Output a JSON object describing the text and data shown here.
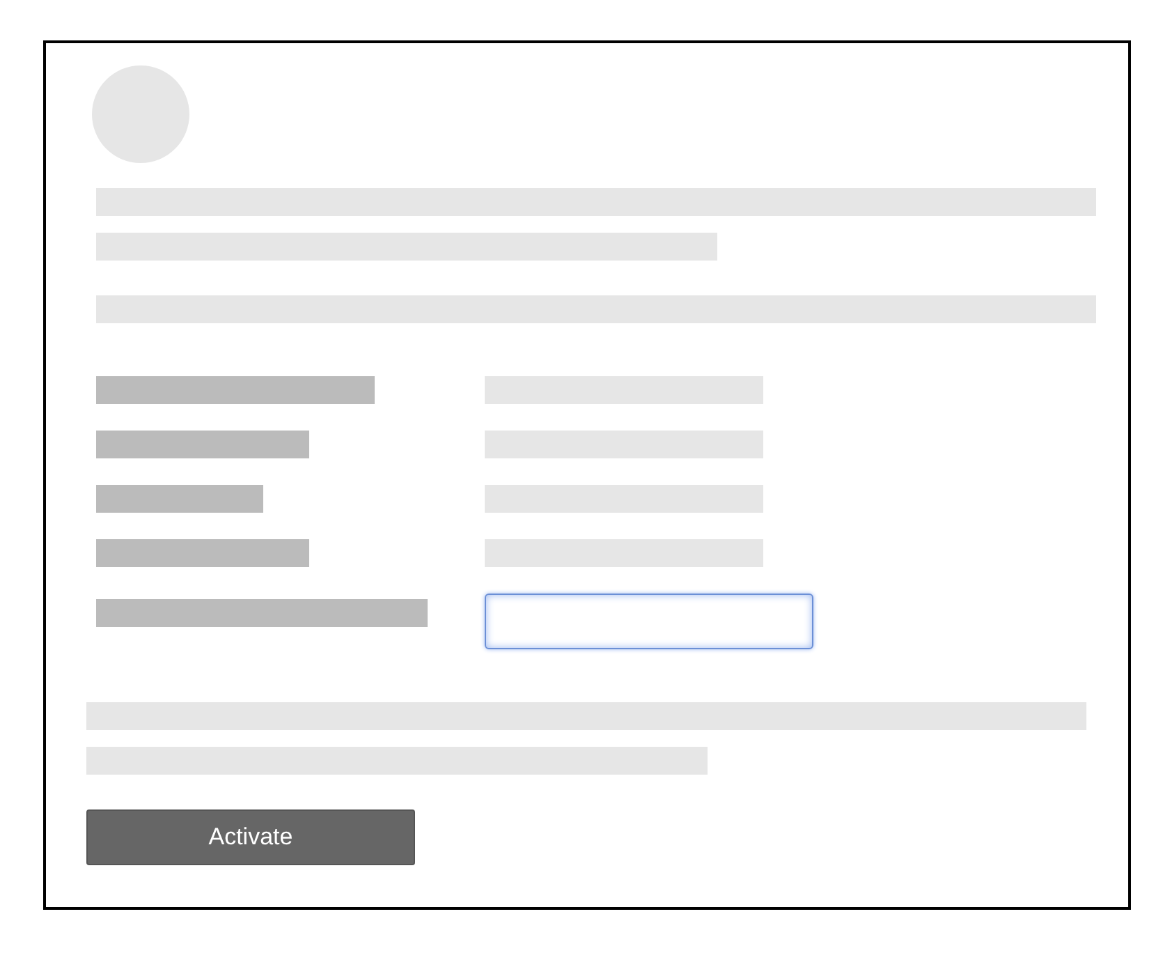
{
  "activation_field": {
    "focused": true
  },
  "activate_button": {
    "label": "Activate"
  }
}
